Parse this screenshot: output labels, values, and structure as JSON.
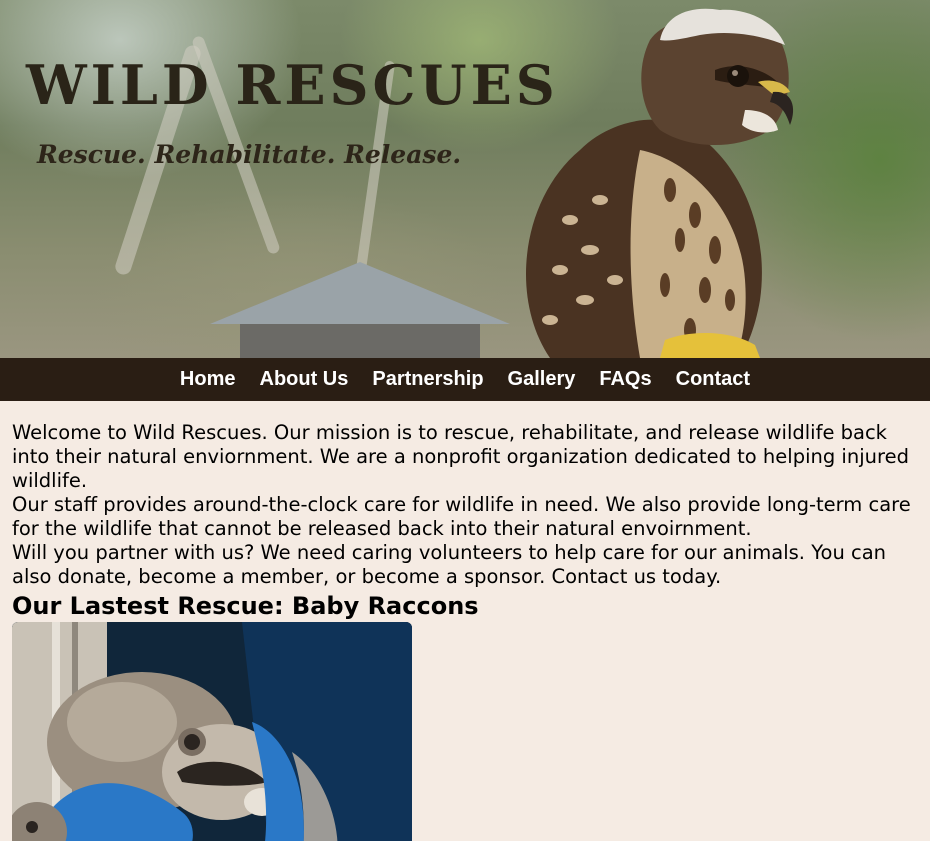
{
  "header": {
    "logo_text": "WILD RESCUES",
    "tagline": "Rescue. Rehabilitate. Release.",
    "hero_image": "juvenile-hawk-photo"
  },
  "nav": {
    "items": [
      {
        "label": "Home"
      },
      {
        "label": "About Us"
      },
      {
        "label": "Partnership"
      },
      {
        "label": "Gallery"
      },
      {
        "label": "FAQs"
      },
      {
        "label": "Contact"
      }
    ]
  },
  "main": {
    "paragraphs": [
      "Welcome to Wild Rescues. Our mission is to rescue, rehabilitate, and release wildlife back into their natural enviornment. We are a nonprofit organization dedicated to helping injured wildlife.",
      "Our staff provides around-the-clock care for wildlife in need. We also provide long-term care for the wildlife that cannot be released back into their natural envoirnment.",
      "Will you partner with us? We need caring volunteers to help care for our animals. You can also donate, become a member, or become a sponsor. Contact us today."
    ],
    "latest_rescue": {
      "heading": "Our Lastest Rescue: Baby Raccons",
      "image": "baby-raccoons-photo"
    }
  },
  "colors": {
    "nav_background": "#2a1e14",
    "page_background": "#f5ebe3",
    "logo_text": "#2a2418"
  }
}
